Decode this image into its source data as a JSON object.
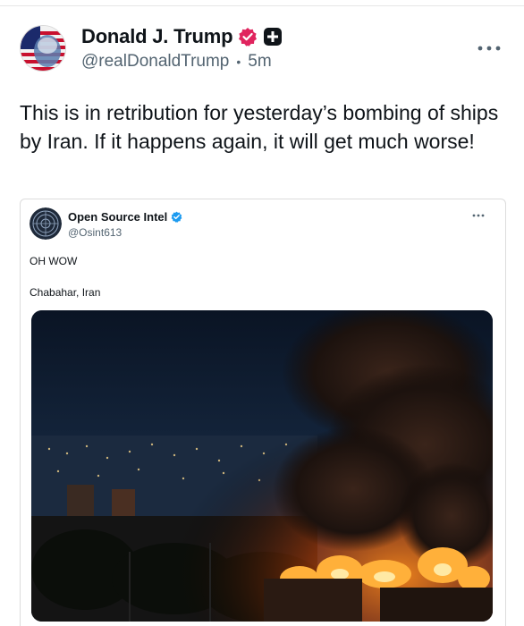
{
  "post": {
    "author_name": "Donald J. Trump",
    "author_handle": "@realDonaldTrump",
    "separator": "•",
    "timestamp": "5m",
    "text": "This is in retribution for yesterday’s bombing of ships by Iran. If it happens again, it will get much worse!"
  },
  "embed": {
    "author_name": "Open Source Intel",
    "author_handle": "@Osint613",
    "line1": "OH WOW",
    "line2": "Chabahar, Iran"
  },
  "colors": {
    "verified_pink": "#e0245e",
    "verified_blue": "#1d9bf0",
    "handle_gray": "#536471"
  }
}
